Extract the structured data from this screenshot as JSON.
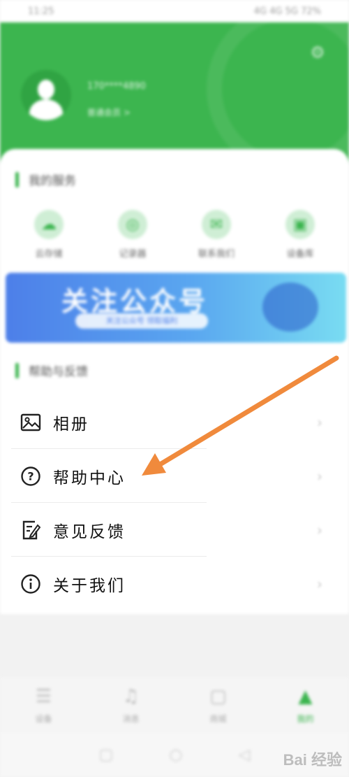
{
  "status_bar": {
    "time": "11:25",
    "indicators": "4G 4G 5G 72%"
  },
  "header": {
    "user_name": "170****4890",
    "user_subtitle": "普通会员 >",
    "top_icon": "settings-icon"
  },
  "sections": {
    "services_title": "我的服务",
    "help_title": "帮助与反馈"
  },
  "features": [
    {
      "label": "云存储",
      "icon": "cloud-icon"
    },
    {
      "label": "记录器",
      "icon": "recorder-icon"
    },
    {
      "label": "联系我们",
      "icon": "chat-icon"
    },
    {
      "label": "设备库",
      "icon": "device-icon"
    }
  ],
  "banner": {
    "title": "关注公众号",
    "subtitle": "关注公众号 领取福利"
  },
  "menu": [
    {
      "label": "相册",
      "icon": "image-icon"
    },
    {
      "label": "帮助中心",
      "icon": "question-circle-icon"
    },
    {
      "label": "意见反馈",
      "icon": "edit-document-icon"
    },
    {
      "label": "关于我们",
      "icon": "info-circle-icon"
    }
  ],
  "tabs": [
    {
      "label": "设备",
      "icon": "list-icon"
    },
    {
      "label": "消息",
      "icon": "bell-icon"
    },
    {
      "label": "商城",
      "icon": "shop-icon"
    },
    {
      "label": "我的",
      "icon": "person-icon"
    }
  ],
  "watermark": "Bai 经验",
  "colors": {
    "brand": "#3cb54f",
    "arrow": "#f08a3c"
  }
}
